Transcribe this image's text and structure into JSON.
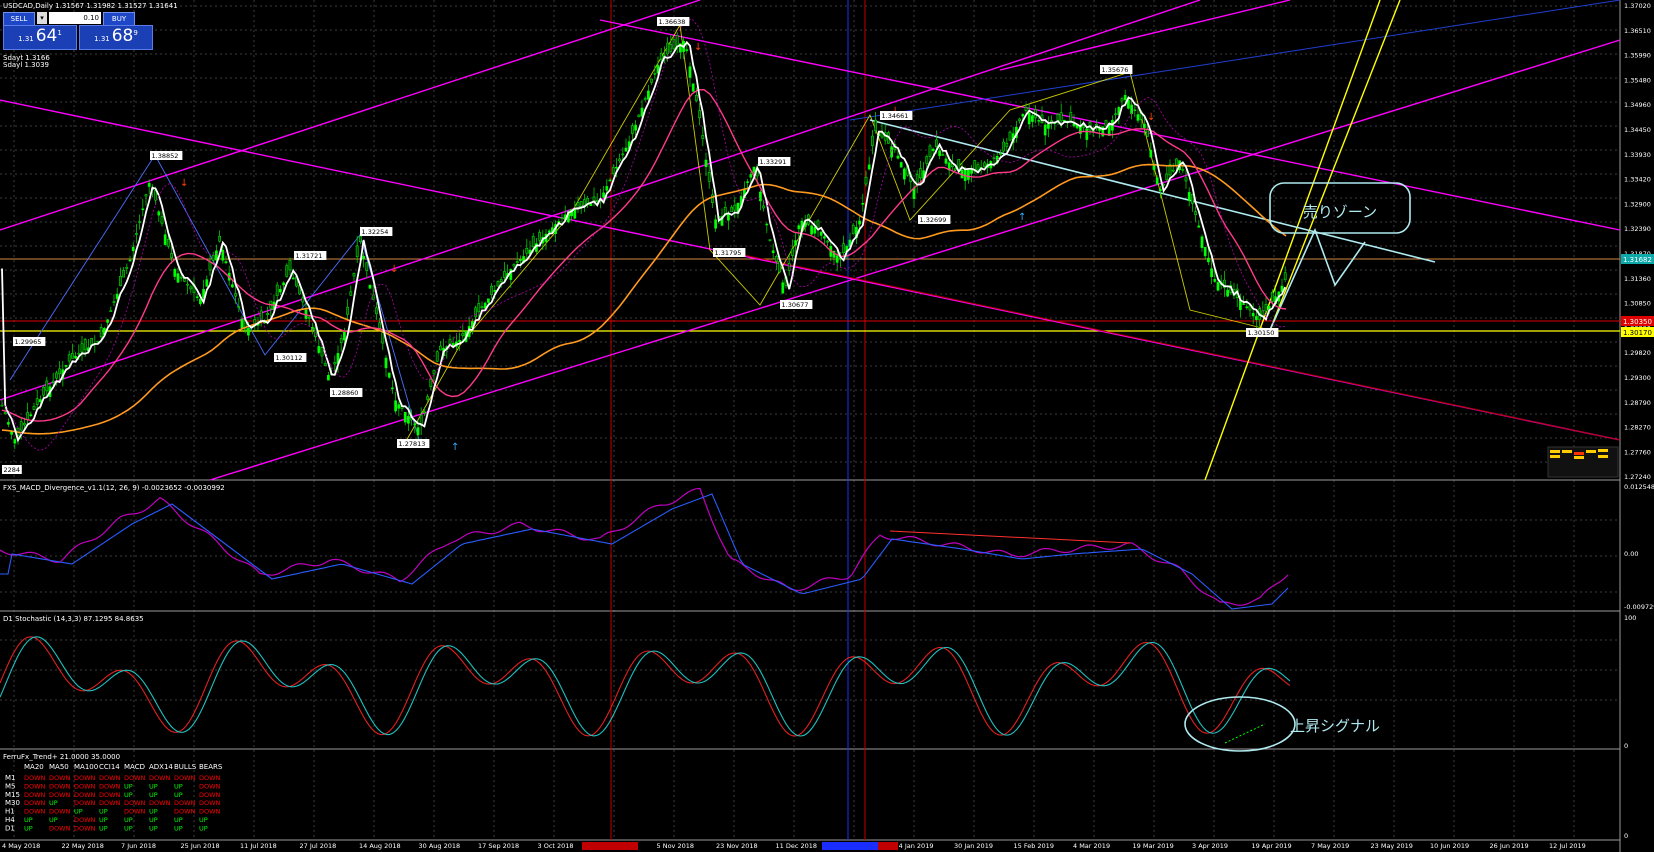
{
  "window": {
    "symbol_info": "USDCAD,Daily  1.31567 1.31982 1.31527 1.31641",
    "indicator_lines": [
      "Sdayt 1.3166",
      "Sdayl 1.3039"
    ]
  },
  "trade_panel": {
    "sell_label": "SELL",
    "buy_label": "BUY",
    "lot_value": "0.10",
    "dropdown_glyph": "▾",
    "bid": {
      "prefix": "1.31",
      "big": "64",
      "sup": "1"
    },
    "ask": {
      "prefix": "1.31",
      "big": "68",
      "sup": "9"
    }
  },
  "price_axis": {
    "labels": [
      "1.37020",
      "1.36510",
      "1.35990",
      "1.35480",
      "1.34960",
      "1.34450",
      "1.33930",
      "1.33420",
      "1.32900",
      "1.32390",
      "1.31870",
      "1.31360",
      "1.30850",
      "1.30330",
      "1.29820",
      "1.29300",
      "1.28790",
      "1.28270",
      "1.27760",
      "1.27240"
    ],
    "current_price": "1.31682",
    "red_line_price": "1.30350",
    "yellow_line_price": "1.30170"
  },
  "swing_labels": [
    "1.38852",
    "1.31721",
    "1.32254",
    "1.30112",
    "1.28860",
    "1.27813",
    "1.36638",
    "1.31795",
    "1.33291",
    "1.30677",
    "1.34661",
    "1.32699",
    "1.35676",
    "1.30150",
    "1.29965",
    "2284"
  ],
  "annotations": {
    "sell_zone": "売りゾーン",
    "rise_signal": "上昇シグナル"
  },
  "macd_panel": {
    "title": "FXS_MACD_Divergence_v1.1(12, 26, 9) -0.0023652 -0.0030992",
    "axis": [
      "0.0125481",
      "0.00",
      "-0.009729"
    ]
  },
  "stoch_panel": {
    "title": "D1 Stochastic (14,3,3) 87.1295 84.8635",
    "axis": [
      "100",
      "0"
    ]
  },
  "trend_panel": {
    "title": "FerruFx_Trend+ 21.0000 35.0000",
    "headers": [
      "MA20",
      "MA50",
      "MA100",
      "CCI14",
      "MACD",
      "ADX14",
      "BULLS",
      "BEARS"
    ],
    "rows": [
      {
        "tf": "M1",
        "values": [
          "DOWN",
          "DOWN",
          "DOWN",
          "DOWN",
          "DOWN",
          "DOWN",
          "DOWN",
          "DOWN"
        ]
      },
      {
        "tf": "M5",
        "values": [
          "DOWN",
          "DOWN",
          "DOWN",
          "DOWN",
          "UP",
          "UP",
          "UP",
          "DOWN"
        ]
      },
      {
        "tf": "M15",
        "values": [
          "DOWN",
          "DOWN",
          "DOWN",
          "DOWN",
          "UP",
          "UP",
          "UP",
          "DOWN"
        ]
      },
      {
        "tf": "M30",
        "values": [
          "DOWN",
          "UP",
          "DOWN",
          "DOWN",
          "DOWN",
          "DOWN",
          "DOWN",
          "DOWN"
        ]
      },
      {
        "tf": "H1",
        "values": [
          "DOWN",
          "DOWN",
          "UP",
          "UP",
          "DOWN",
          "UP",
          "DOWN",
          "DOWN"
        ]
      },
      {
        "tf": "H4",
        "values": [
          "UP",
          "UP",
          "DOWN",
          "UP",
          "UP",
          "UP",
          "UP",
          "UP"
        ]
      },
      {
        "tf": "D1",
        "values": [
          "UP",
          "DOWN",
          "DOWN",
          "UP",
          "UP",
          "UP",
          "UP",
          "UP"
        ]
      }
    ],
    "axis": [
      "0"
    ]
  },
  "time_axis": [
    "4 May 2018",
    "22 May 2018",
    "7 Jun 2018",
    "25 Jun 2018",
    "11 Jul 2018",
    "27 Jul 2018",
    "14 Aug 2018",
    "30 Aug 2018",
    "17 Sep 2018",
    "3 Oct 2018",
    "19 Oct 2018",
    "5 Nov 2018",
    "23 Nov 2018",
    "11 Dec 2018",
    "26 Dec 2018",
    "14 Jan 2019",
    "30 Jan 2019",
    "15 Feb 2019",
    "4 Mar 2019",
    "19 Mar 2019",
    "3 Apr 2019",
    "19 Apr 2019",
    "7 May 2019",
    "23 May 2019",
    "10 Jun 2019",
    "26 Jun 2019",
    "12 Jul 2019"
  ],
  "colors": {
    "background": "#000000",
    "grid": "#4a4a4a",
    "bull_candle": "#00ff00",
    "bear_candle": "#00ff00",
    "ma_fast": "#ffffff",
    "ma_mid": "#ff3a8a",
    "ma_slow": "#ff9a1f",
    "channel": "#ff00ff",
    "trend_yellow": "#ffff00",
    "trend_cyan": "#aeeaf0",
    "up_text": "#00ff00",
    "down_text": "#ff0000"
  }
}
